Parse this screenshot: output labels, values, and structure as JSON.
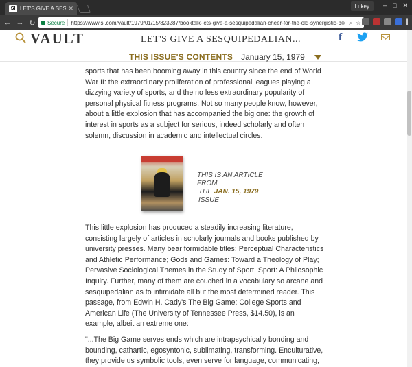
{
  "browser": {
    "tab_title": "LET'S GIVE A SESQUIPED",
    "tab_favicon": "SI",
    "profile": "Lukey",
    "secure_label": "Secure",
    "url": "https://www.si.com/vault/1979/01/15/823287/booktalk-lets-give-a-sesquipedalian-cheer-for-the-old-synergistic-b..."
  },
  "header": {
    "logo": "VAULT",
    "headline": "LET'S GIVE A SESQUIPEDALIAN...",
    "facebook_glyph": "f",
    "issue_label": "THIS ISSUE'S CONTENTS",
    "issue_date": "January 15, 1979"
  },
  "article": {
    "paragraph1": "sports that has been booming away in this country since the end of World War II: the extraordinary proliferation of professional leagues playing a dizzying variety of sports, and the no less extraordinary popularity of personal physical fitness programs. Not so many people know, however, about a little explosion that has accompanied the big one: the growth of interest in sports as a subject for serious, indeed scholarly and often solemn, discussion in academic and intellectual circles.",
    "caption_prefix": "THIS IS AN ARTICLE FROM",
    "caption_the": "THE",
    "caption_date": "JAN. 15, 1979",
    "caption_suffix": "ISSUE",
    "paragraph2": "This little explosion has produced a steadily increasing literature, consisting largely of articles in scholarly journals and books published by university presses. Many bear formidable titles: Perceptual Characteristics and Athletic Performance; Gods and Games: Toward a Theology of Play; Pervasive Sociological Themes in the Study of Sport; Sport: A Philosophic Inquiry. Further, many of them are couched in a vocabulary so arcane and sesquipedalian as to intimidate all but the most determined reader. This passage, from Edwin H. Cady's The Big Game: College Sports and American Life (The University of Tennessee Press, $14.50), is an example, albeit an extreme one:",
    "paragraph3": "\"...The Big Game serves ends which are intrapsychically bonding and bounding, cathartic, egosyntonic, sublimating, transforming. Enculturative, they provide us symbolic tools, even serve for language, communicating, forging"
  },
  "colors": {
    "accent_gold": "#8a6d1f",
    "facebook": "#3b5998",
    "twitter": "#1da1f2"
  }
}
